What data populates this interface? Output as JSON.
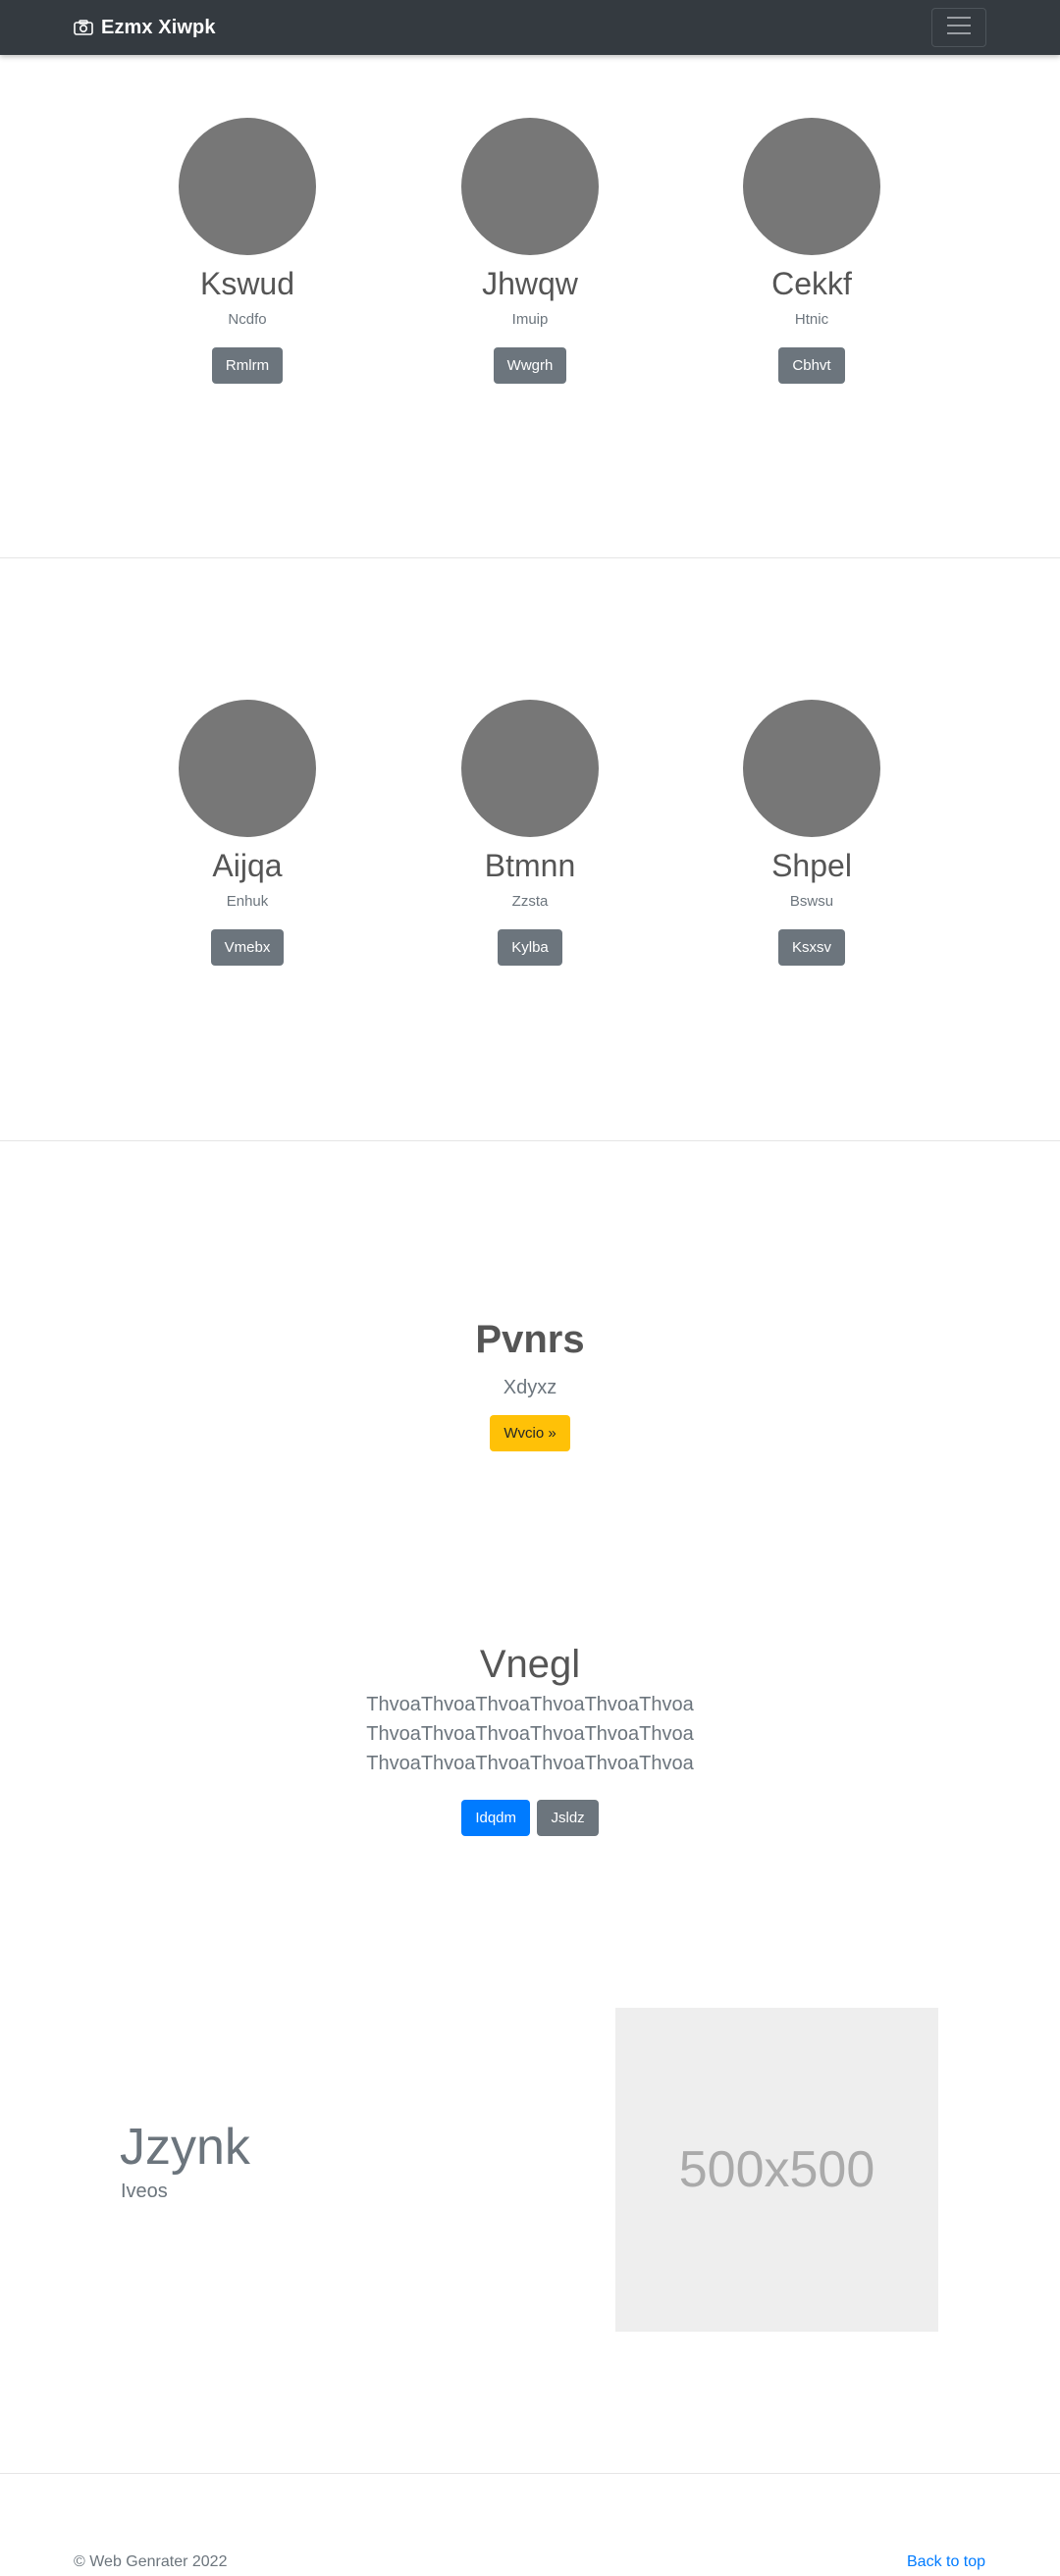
{
  "navbar": {
    "brand": "Ezmx Xiwpk",
    "brand_icon": "camera-icon",
    "toggler_icon": "hamburger-menu-icon"
  },
  "team_row_1": [
    {
      "name": "Kswud",
      "role": "Ncdfo",
      "button": "Rmlrm"
    },
    {
      "name": "Jhwqw",
      "role": "Imuip",
      "button": "Wwgrh"
    },
    {
      "name": "Cekkf",
      "role": "Htnic",
      "button": "Cbhvt"
    }
  ],
  "team_row_2": [
    {
      "name": "Aijqa",
      "role": "Enhuk",
      "button": "Vmebx"
    },
    {
      "name": "Btmnn",
      "role": "Zzsta",
      "button": "Kylba"
    },
    {
      "name": "Shpel",
      "role": "Bswsu",
      "button": "Ksxsv"
    }
  ],
  "callout": {
    "title": "Pvnrs",
    "subtitle": "Xdyxz",
    "button": "Wvcio »"
  },
  "hero": {
    "title": "Vnegl",
    "lines": [
      "ThvoaThvoaThvoaThvoaThvoaThvoa",
      "ThvoaThvoaThvoaThvoaThvoaThvoa",
      "ThvoaThvoaThvoaThvoaThvoaThvoa"
    ],
    "primary_button": "Idqdm",
    "secondary_button": "Jsldz"
  },
  "feature": {
    "title": "Jzynk",
    "subtitle": "Iveos",
    "image_placeholder": "500x500"
  },
  "footer": {
    "copyright": "© Web Genrater 2022",
    "back_to_top": "Back to top"
  },
  "colors": {
    "navbar_bg": "#343a40",
    "avatar": "#777777",
    "secondary": "#6c757d",
    "primary": "#007bff",
    "warning": "#ffc107",
    "placeholder_bg": "#eeeeee"
  }
}
